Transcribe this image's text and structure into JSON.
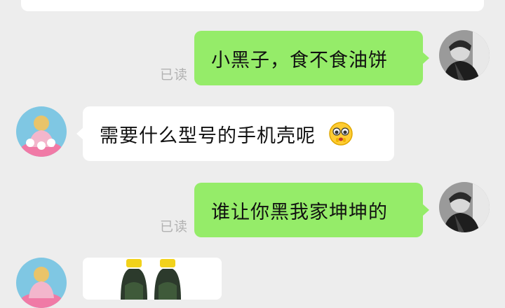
{
  "messages": [
    {
      "side": "out",
      "text": "小黑子，食不食油饼",
      "status": "已读"
    },
    {
      "side": "in",
      "text": "需要什么型号的手机壳呢",
      "emoji": "pleading-face-emoji"
    },
    {
      "side": "out",
      "text": "谁让你黑我家坤坤的",
      "status": "已读"
    },
    {
      "side": "in",
      "type": "image",
      "image": "two-green-bottles-photo"
    }
  ],
  "colors": {
    "background": "#ededed",
    "outgoing_bubble": "#95ec69",
    "incoming_bubble": "#ffffff",
    "read_status": "#b2b2b2"
  }
}
